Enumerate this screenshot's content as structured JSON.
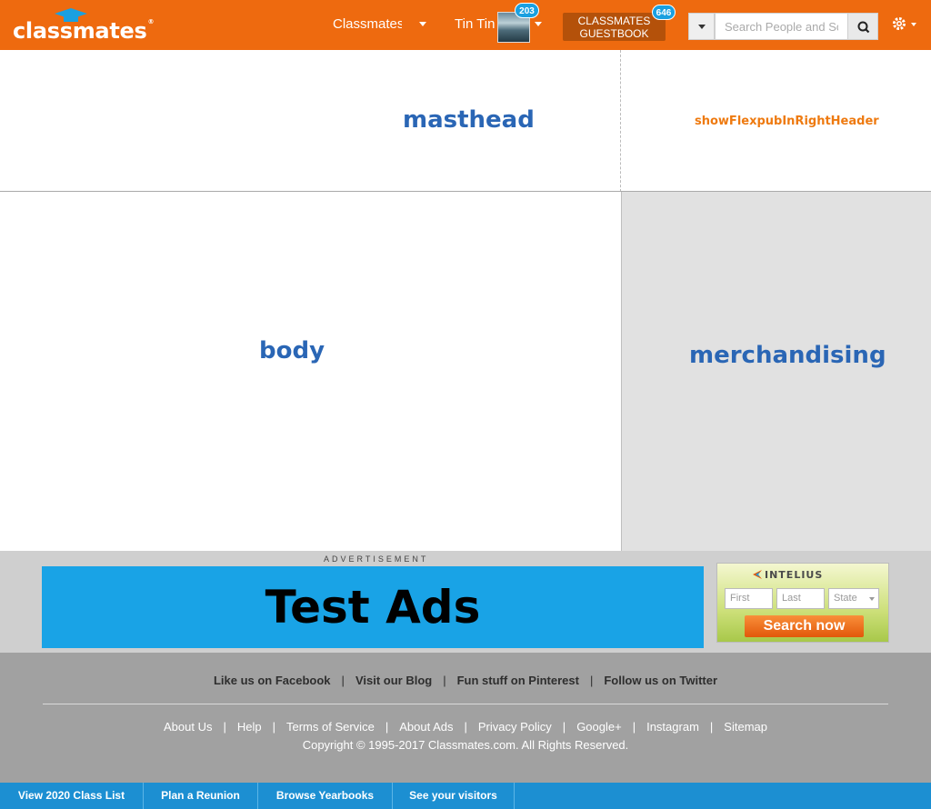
{
  "header": {
    "logo_text": "classmates",
    "logo_mark": "®",
    "nav_school_label": "Classmates Te",
    "nav_user_label": "Tin Tin",
    "notifications_count": "203",
    "guestbook_line1": "CLASSMATES",
    "guestbook_line2": "GUESTBOOK",
    "guestbook_count": "646",
    "search_placeholder": "Search People and Schools",
    "colors": {
      "brand_orange": "#ee6a0f",
      "badge_blue": "#1aa0e0"
    }
  },
  "layout_labels": {
    "masthead": "masthead",
    "right_header": "showFlexpubInRightHeader",
    "body": "body",
    "merchandising": "merchandising"
  },
  "ads": {
    "caption": "ADVERTISEMENT",
    "test_ad_text": "Test Ads",
    "intelius": {
      "brand": "INTELIUS",
      "first_placeholder": "First",
      "last_placeholder": "Last",
      "state_placeholder": "State",
      "button_label": "Search now"
    }
  },
  "footer": {
    "social_links": [
      "Like us on Facebook",
      "Visit our Blog",
      "Fun stuff on Pinterest",
      "Follow us on Twitter"
    ],
    "links": [
      "About Us",
      "Help",
      "Terms of Service",
      "About Ads",
      "Privacy Policy",
      "Google+",
      "Instagram",
      "Sitemap"
    ],
    "copyright": "Copyright © 1995-2017 Classmates.com. All Rights Reserved."
  },
  "bottom_bar": {
    "items": [
      "View 2020 Class List",
      "Plan a Reunion",
      "Browse Yearbooks",
      "See your visitors"
    ]
  }
}
